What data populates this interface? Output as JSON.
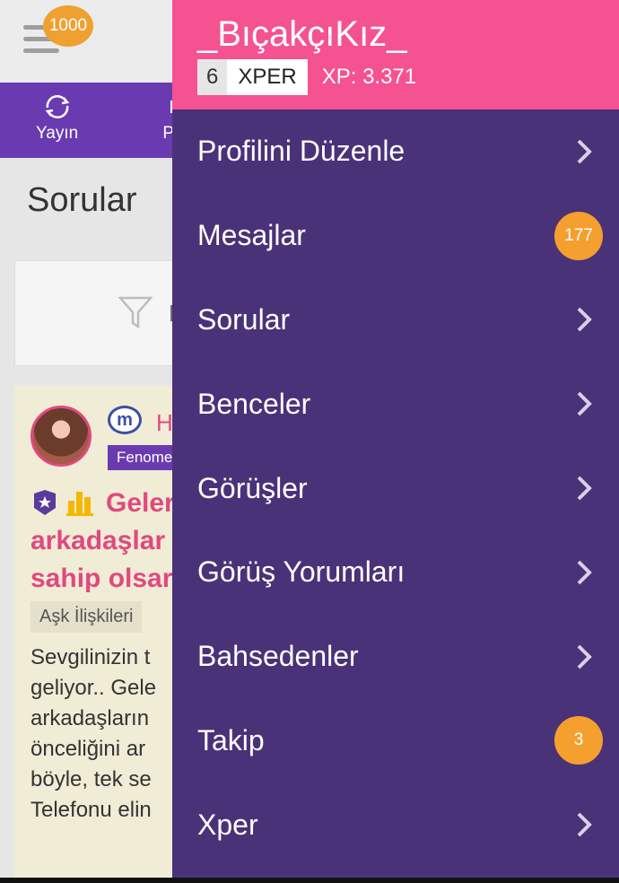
{
  "colors": {
    "drawer_header": "#f55292",
    "drawer_bg": "#4a3278",
    "badge": "#f5a02e",
    "nav_bg": "#6a3bb0",
    "card_bg": "#f0ecd6",
    "accent_pink": "#e0497f"
  },
  "app": {
    "coins": "1000",
    "nav": [
      {
        "label": "Yayın",
        "icon": "refresh-icon"
      },
      {
        "label": "Pa",
        "icon": "nav-icon"
      }
    ],
    "section_title": "Sorular",
    "filter_text": "L",
    "card": {
      "author": "H",
      "rank": "Fenome",
      "title_lines": [
        "Geler",
        "arkadaşlar",
        "sahip olsar"
      ],
      "topic": "Aşk İlişkileri",
      "body_lines": [
        "Sevgilinizin t",
        "geliyor.. Gele",
        "arkadaşların",
        "önceliğini ar",
        "böyle, tek se",
        "Telefonu elin"
      ]
    }
  },
  "drawer": {
    "username": "_BıçakçıKız_",
    "level": "6",
    "rank": "XPER",
    "xp": "XP: 3.371",
    "items": [
      {
        "label": "Profilini Düzenle",
        "badge": null
      },
      {
        "label": "Mesajlar",
        "badge": "177"
      },
      {
        "label": "Sorular",
        "badge": null
      },
      {
        "label": "Benceler",
        "badge": null
      },
      {
        "label": "Görüşler",
        "badge": null
      },
      {
        "label": "Görüş Yorumları",
        "badge": null
      },
      {
        "label": "Bahsedenler",
        "badge": null
      },
      {
        "label": "Takip",
        "badge": "3"
      },
      {
        "label": "Xper",
        "badge": null
      }
    ]
  }
}
